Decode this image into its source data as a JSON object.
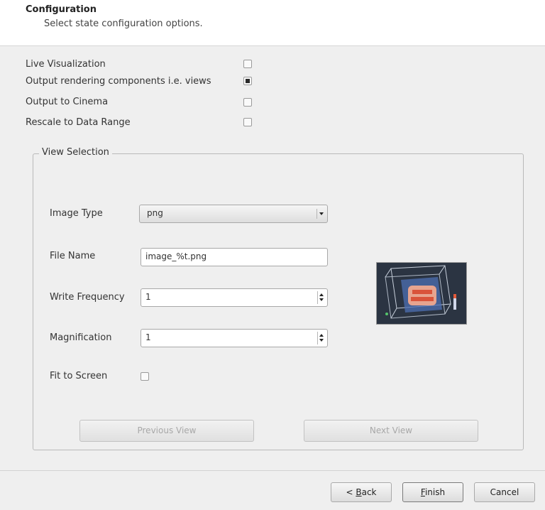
{
  "header": {
    "title": "Configuration",
    "subtitle": "Select state configuration options."
  },
  "options": [
    {
      "label": "Live Visualization",
      "checked": false
    },
    {
      "label": "Output rendering components i.e. views",
      "checked": true
    },
    {
      "label": "Output to Cinema",
      "checked": false
    },
    {
      "label": "Rescale to Data Range",
      "checked": false
    }
  ],
  "view_selection": {
    "title": "View Selection",
    "image_type": {
      "label": "Image Type",
      "value": "png"
    },
    "file_name": {
      "label": "File Name",
      "value": "image_%t.png"
    },
    "write_frequency": {
      "label": "Write Frequency",
      "value": "1"
    },
    "magnification": {
      "label": "Magnification",
      "value": "1"
    },
    "fit_to_screen": {
      "label": "Fit to Screen",
      "checked": false
    },
    "previous_view": "Previous View",
    "next_view": "Next View"
  },
  "footer": {
    "back_prefix": "< ",
    "back_mnemonic": "B",
    "back_rest": "ack",
    "finish_mnemonic": "F",
    "finish_rest": "inish",
    "cancel": "Cancel"
  }
}
